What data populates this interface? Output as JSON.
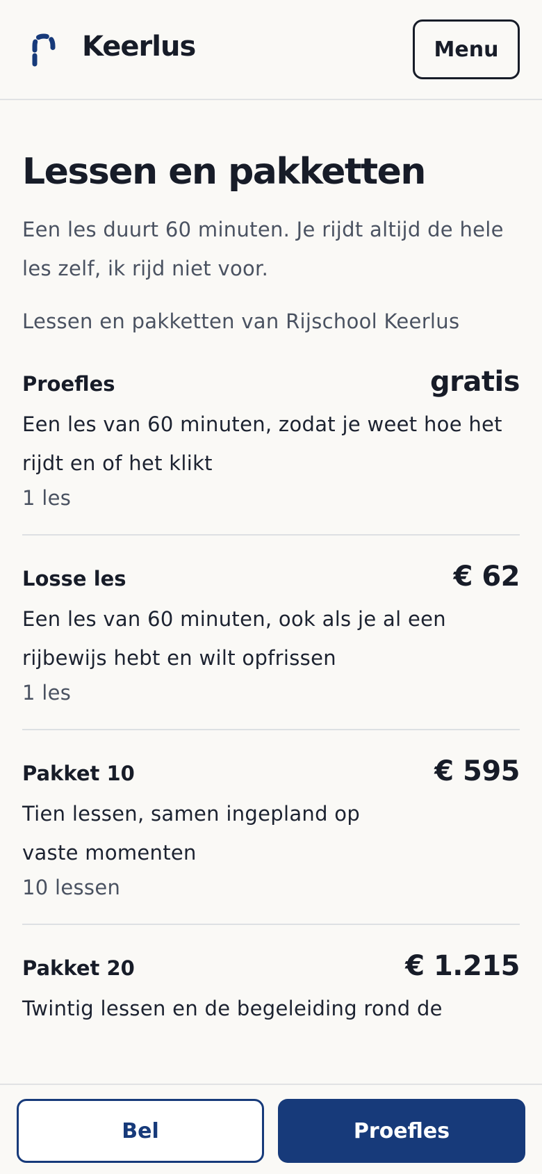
{
  "header": {
    "brand": "Keerlus",
    "menu_label": "Menu",
    "logo_icon": "keerlus-logo-icon",
    "accent": "#173a7a"
  },
  "main": {
    "title": "Lessen en pakketten",
    "intro": "Een les duurt 60 minuten. Je rijdt altijd de hele les zelf, ik rijd niet voor.",
    "subheading": "Lessen en pakketten van Rijschool Keerlus",
    "items": [
      {
        "name": "Proefles",
        "price": "gratis",
        "description": "Een les van 60 minuten, zodat je weet hoe het rijdt en of het klikt",
        "count": "1 les"
      },
      {
        "name": "Losse les",
        "price": "€ 62",
        "description": "Een les van 60 minuten, ook als je al een rijbewijs hebt en wilt opfrissen",
        "count": "1 les"
      },
      {
        "name": "Pakket 10",
        "price": "€ 595",
        "description": "Tien lessen, samen ingepland op vaste momenten",
        "count": "10 lessen"
      },
      {
        "name": "Pakket 20",
        "price": "€ 1.215",
        "description": "Twintig lessen en de begeleiding rond de",
        "count": ""
      }
    ]
  },
  "bottom_bar": {
    "call_label": "Bel",
    "trial_label": "Proefles"
  }
}
